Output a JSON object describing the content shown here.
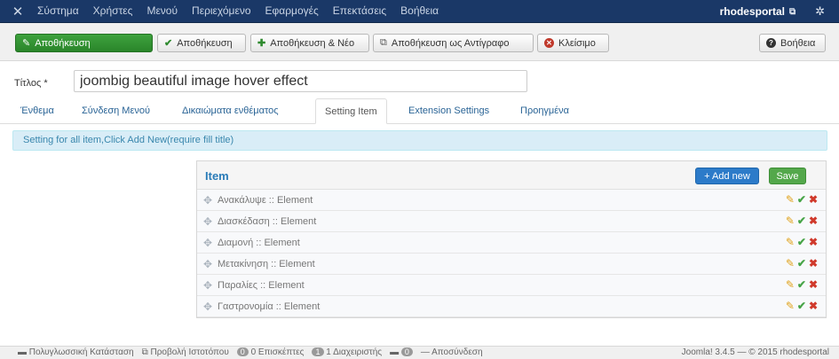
{
  "topnav": {
    "items": [
      "Σύστημα",
      "Χρήστες",
      "Μενού",
      "Περιεχόμενο",
      "Εφαρμογές",
      "Επεκτάσεις",
      "Βοήθεια"
    ],
    "user": "rhodesportal"
  },
  "toolbar": {
    "save_main": "Αποθήκευση",
    "save": "Αποθήκευση",
    "save_new": "Αποθήκευση & Νέο",
    "save_copy": "Αποθήκευση ως Αντίγραφο",
    "close": "Κλείσιμο",
    "help": "Βοήθεια"
  },
  "form": {
    "title_label": "Τίτλος *",
    "title_value": "joombig beautiful image hover effect"
  },
  "tabs": [
    "Ένθεμα",
    "Σύνδεση Μενού",
    "Δικαιώματα ενθέματος",
    "Setting Item",
    "Extension Settings",
    "Προηγμένα"
  ],
  "info_text": "Setting for all item,Click Add New(require fill title)",
  "panel": {
    "title": "Item",
    "add_new": "+ Add new",
    "save": "Save",
    "items": [
      "Ανακάλυψε :: Element",
      "Διασκέδαση :: Element",
      "Διαμονή :: Element",
      "Μετακίνηση :: Element",
      "Παραλίες :: Element",
      "Γαστρονομία :: Element"
    ]
  },
  "statusbar": {
    "multilang": "Πολυγλωσσική Κατάσταση",
    "preview": "Προβολή Ιστοτόπου",
    "visitors_count": "0",
    "visitors": "0 Επισκέπτες",
    "admins_count": "1",
    "admins": "1 Διαχειριστής",
    "messages_count": "0",
    "logout": "Αποσύνδεση",
    "version": "Joomla! 3.4.5 — © 2015 rhodesportal"
  },
  "colors": {
    "topbar": "#1a3867",
    "save_green": "#3ea23e",
    "add_blue": "#2c7bc9",
    "info_bg": "#d9edf7"
  }
}
